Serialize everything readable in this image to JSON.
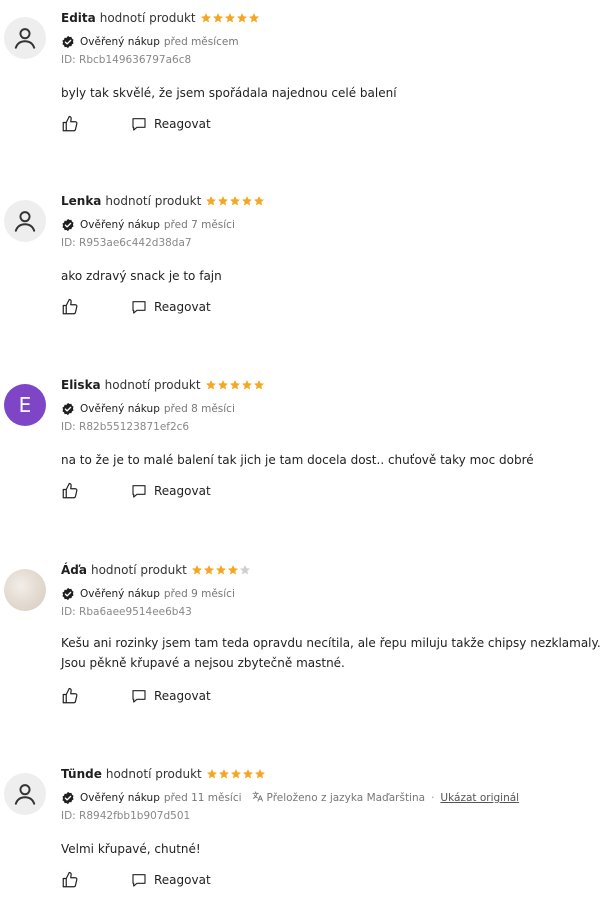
{
  "action_label": "hodnotí produkt",
  "verified_label": "Ověřený nákup",
  "reply_label": "Reagovat",
  "colors": {
    "star_filled": "#f5a623",
    "star_empty": "#d0d0d0",
    "avatar_purple": "#7e46c7"
  },
  "reviews": [
    {
      "author": "Edita",
      "rating": 5,
      "time": "před měsícem",
      "id": "ID: Rbcb149636797a6c8",
      "text": "byly tak skvělé, že jsem spořádala najednou celé balení"
    },
    {
      "author": "Lenka",
      "rating": 5,
      "time": "před 7 měsíci",
      "id": "ID: R953ae6c442d38da7",
      "text": "ako zdravý snack je to fajn"
    },
    {
      "author": "Eliska",
      "rating": 5,
      "time": "před 8 měsíci",
      "id": "ID: R82b55123871ef2c6",
      "avatar_letter": "E",
      "text": "na to že je to malé balení tak jich je tam docela dost.. chuťově taky moc dobré"
    },
    {
      "author": "Áďa",
      "rating": 4,
      "time": "před 9 měsíci",
      "id": "ID: Rba6aee9514ee6b43",
      "text_line1": "Kešu ani rozinky jsem tam teda opravdu necítila, ale řepu miluju takže chipsy nezklamaly.",
      "text_line2": "Jsou pěkně křupavé a nejsou zbytečně mastné."
    },
    {
      "author": "Tünde",
      "rating": 5,
      "time": "před 11 měsíci",
      "id": "ID: R8942fbb1b907d501",
      "translated_note": "Přeloženo z jazyka Maďarština",
      "show_original": "Ukázat originál",
      "text": "Velmi křupavé, chutné!"
    }
  ]
}
